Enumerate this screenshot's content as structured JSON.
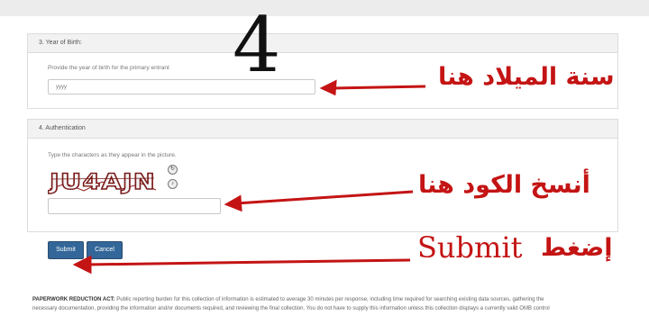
{
  "year_section": {
    "heading": "3. Year of Birth:",
    "instruction": "Provide the year of birth for the primary entrant",
    "input_placeholder": "yyyy"
  },
  "auth_section": {
    "heading": "4. Authentication",
    "instruction": "Type the characters as they appear in the picture.",
    "captcha_text": "JU4AJN",
    "input_value": ""
  },
  "buttons": {
    "submit": "Submit",
    "cancel": "Cancel"
  },
  "annotations": {
    "step_number": "4",
    "year_label": "سنة الميلاد هنا",
    "code_label": "أنسخ الكود هنا",
    "submit_label_word": "Submit",
    "submit_label_arabic": "إضغط",
    "arrow_color": "#c41414"
  },
  "footer": {
    "title": "PAPERWORK REDUCTION ACT:",
    "line1": "Public reporting burden for this collection of information is estimated to average 30 minutes per response, including time required for searching existing data sources, gathering the",
    "line2": "necessary documentation, providing the information and/or documents required, and reviewing the final collection. You do not have to supply this information unless this collection displays a currently valid OMB control"
  }
}
